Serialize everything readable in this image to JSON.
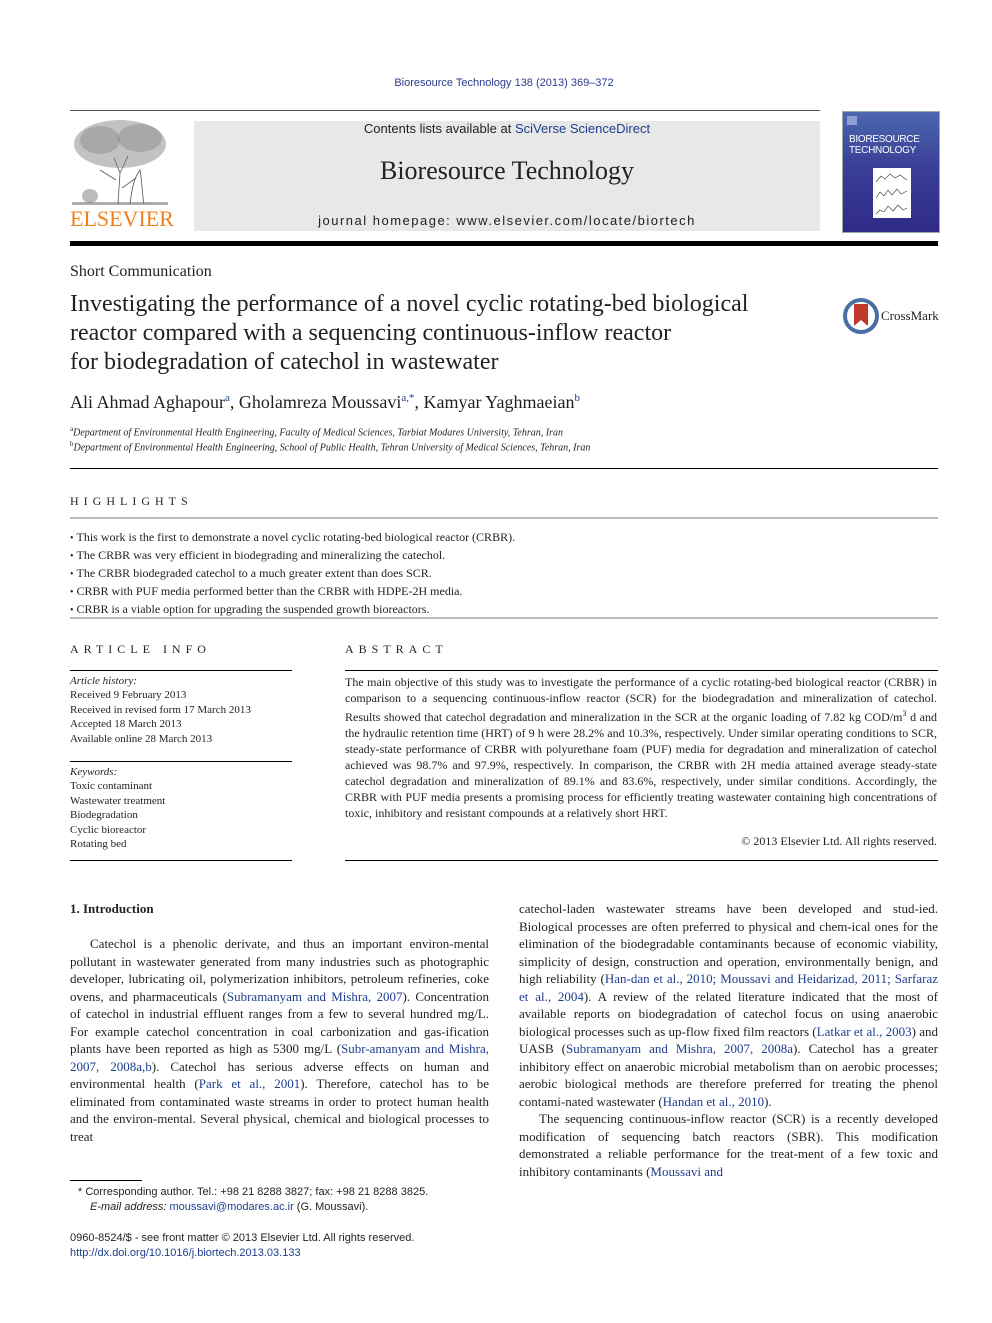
{
  "header": {
    "journal_ref": "Bioresource Technology 138 (2013) 369–372",
    "contents_prefix": "Contents lists available at ",
    "contents_link": "SciVerse ScienceDirect",
    "journal_title": "Bioresource Technology",
    "homepage_prefix": "journal homepage: ",
    "homepage_url": "www.elsevier.com/locate/biortech",
    "publisher_logo_text": "ELSEVIER",
    "cover_title": "BIORESOURCE TECHNOLOGY",
    "brand_orange": "#f07f1b",
    "link_color": "#1d3d8f"
  },
  "article": {
    "type": "Short Communication",
    "title_lines": [
      "Investigating the performance of a novel cyclic rotating-bed biological",
      "reactor compared with a sequencing continuous-inflow reactor",
      "for biodegradation of catechol in wastewater"
    ],
    "crossmark_label": "CrossMark",
    "authors": [
      {
        "name": "Ali Ahmad Aghapour",
        "sup": "a"
      },
      {
        "name": "Gholamreza Moussavi",
        "sup": "a,*"
      },
      {
        "name": "Kamyar Yaghmaeian",
        "sup": "b"
      }
    ],
    "affiliations": [
      {
        "sup": "a",
        "text": "Department of Environmental Health Engineering, Faculty of Medical Sciences, Tarbiat Modares University, Tehran, Iran"
      },
      {
        "sup": "b",
        "text": "Department of Environmental Health Engineering, School of Public Health, Tehran University of Medical Sciences, Tehran, Iran"
      }
    ]
  },
  "highlights": {
    "heading": "HIGHLIGHTS",
    "items": [
      "This work is the first to demonstrate a novel cyclic rotating-bed biological reactor (CRBR).",
      "The CRBR was very efficient in biodegrading and mineralizing the catechol.",
      "The CRBR biodegraded catechol to a much greater extent than does SCR.",
      "CRBR with PUF media performed better than the CRBR with HDPE-2H media.",
      "CRBR is a viable option for upgrading the suspended growth bioreactors."
    ]
  },
  "article_info": {
    "heading": "ARTICLE INFO",
    "history_label": "Article history:",
    "history": [
      "Received 9 February 2013",
      "Received in revised form 17 March 2013",
      "Accepted 18 March 2013",
      "Available online 28 March 2013"
    ],
    "keywords_label": "Keywords:",
    "keywords": [
      "Toxic contaminant",
      "Wastewater treatment",
      "Biodegradation",
      "Cyclic bioreactor",
      "Rotating bed"
    ]
  },
  "abstract": {
    "heading": "ABSTRACT",
    "text_1": "The main objective of this study was to investigate the performance of a cyclic rotating-bed biological reactor (CRBR) in comparison to a sequencing continuous-inflow reactor (SCR) for the biodegradation and mineralization of catechol. Results showed that catechol degradation and mineralization in the SCR at the organic loading of 7.82 kg COD/m",
    "sup": "3",
    "text_2": " d and the hydraulic retention time (HRT) of 9 h were 28.2% and 10.3%, respectively. Under similar operating conditions to SCR, steady-state performance of CRBR with polyurethane foam (PUF) media for degradation and mineralization of catechol achieved was 98.7% and 97.9%, respectively. In comparison, the CRBR with 2H media attained average steady-state catechol degradation and mineralization of 89.1% and 83.6%, respectively, under similar conditions. Accordingly, the CRBR with PUF media presents a promising process for efficiently treating wastewater containing high concentrations of toxic, inhibitory and resistant compounds at a relatively short HRT.",
    "copyright": "© 2013 Elsevier Ltd. All rights reserved."
  },
  "body": {
    "section_heading": "1. Introduction",
    "left_col": [
      {
        "t": "Catechol is a phenolic derivate, and thus an important environ-mental pollutant in wastewater generated from many industries such as photographic developer, lubricating oil, polymerization inhibitors, petroleum refineries, coke ovens, and pharmaceuticals ("
      },
      {
        "link": "Subramanyam and Mishra, 2007"
      },
      {
        "t": "). Concentration of catechol in industrial effluent ranges from a few to several hundred mg/L. For example catechol concentration in coal carbonization and gas-ification plants have been reported as high as 5300 mg/L ("
      },
      {
        "link": "Subr-amanyam and Mishra, 2007, 2008a,b"
      },
      {
        "t": "). Catechol has serious adverse effects on human and environmental health ("
      },
      {
        "link": "Park et al., 2001"
      },
      {
        "t": "). Therefore, catechol has to be eliminated from contaminated waste streams in order to protect human health and the environ-mental. Several physical, chemical and biological processes to treat"
      }
    ],
    "right_col_p1": [
      {
        "t": "catechol-laden wastewater streams have been developed and stud-ied. Biological processes are often preferred to physical and chem-ical ones for the elimination of the biodegradable contaminants because of economic viability, simplicity of design, construction and operation, environmentally benign, and high reliability ("
      },
      {
        "link": "Han-dan et al., 2010; Moussavi and Heidarizad, 2011; Sarfaraz et al., 2004"
      },
      {
        "t": "). A review of the related literature indicated that the most of available reports on biodegradation of catechol focus on using anaerobic biological processes such as up-flow fixed film reactors ("
      },
      {
        "link": "Latkar et al., 2003"
      },
      {
        "t": ") and UASB ("
      },
      {
        "link": "Subramanyam and Mishra, 2007, 2008a"
      },
      {
        "t": "). Catechol has a greater inhibitory effect on anaerobic microbial metabolism than on aerobic processes; aerobic biological methods are therefore preferred for treating the phenol contami-nated wastewater ("
      },
      {
        "link": "Handan et al., 2010"
      },
      {
        "t": ")."
      }
    ],
    "right_col_p2": [
      {
        "t": "The sequencing continuous-inflow reactor (SCR) is a recently developed modification of sequencing batch reactors (SBR). This modification demonstrated a reliable performance for the treat-ment of a few toxic and inhibitory contaminants ("
      },
      {
        "link": "Moussavi and"
      }
    ]
  },
  "footer": {
    "corresponding": "* Corresponding author. Tel.: +98 21 8288 3827; fax: +98 21 8288 3825.",
    "email_label": "E-mail address:",
    "email": "moussavi@modares.ac.ir",
    "email_suffix": " (G. Moussavi).",
    "issn_line": "0960-8524/$ - see front matter © 2013 Elsevier Ltd. All rights reserved.",
    "doi": "http://dx.doi.org/10.1016/j.biortech.2013.03.133"
  }
}
